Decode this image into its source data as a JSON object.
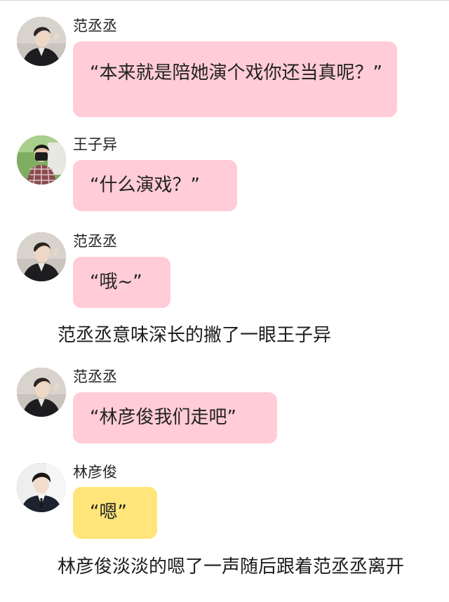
{
  "messages": [
    {
      "sender": "范丞丞",
      "text": "“本来就是陪她演个戏你还当真呢？”",
      "bubble_color": "#ffccd8",
      "avatar_icon": "avatar-fan-chengcheng"
    },
    {
      "sender": "王子异",
      "text": "“什么演戏？”",
      "bubble_color": "#ffccd8",
      "avatar_icon": "avatar-wang-ziyi"
    },
    {
      "sender": "范丞丞",
      "text": "“哦~”",
      "bubble_color": "#ffccd8",
      "avatar_icon": "avatar-fan-chengcheng"
    },
    {
      "sender": "范丞丞",
      "text": "“林彦俊我们走吧”",
      "bubble_color": "#ffccd8",
      "avatar_icon": "avatar-fan-chengcheng"
    },
    {
      "sender": "林彦俊",
      "text": "“嗯”",
      "bubble_color": "#ffe57a",
      "avatar_icon": "avatar-lin-yanjun"
    }
  ],
  "narration": [
    "范丞丞意味深长的撇了一眼王子异",
    "林彦俊淡淡的嗯了一声随后跟着范丞丞离开"
  ]
}
